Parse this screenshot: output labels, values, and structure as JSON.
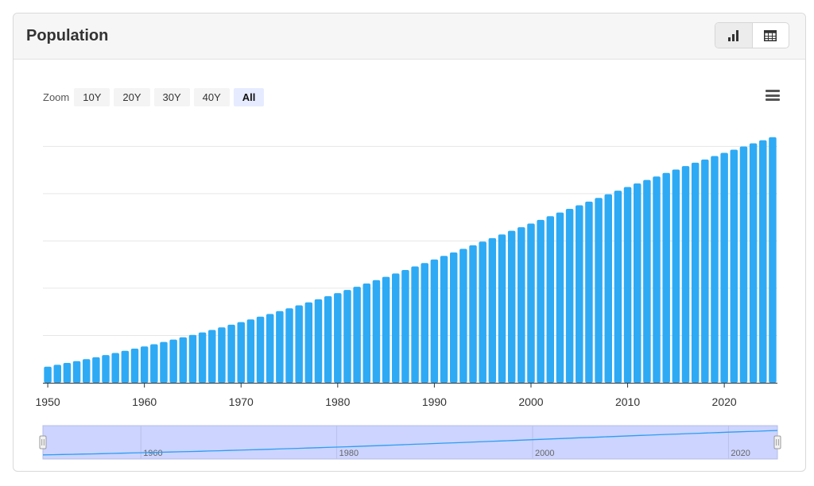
{
  "header": {
    "title": "Population"
  },
  "view_toggle": {
    "chart_icon": "bar-chart-icon",
    "table_icon": "table-icon"
  },
  "zoom": {
    "label": "Zoom",
    "options": [
      "10Y",
      "20Y",
      "30Y",
      "40Y",
      "All"
    ],
    "selected": "All"
  },
  "menu": {
    "icon": "hamburger-menu-icon"
  },
  "colors": {
    "bar": "#2eaaf5",
    "navigator_fill": "#ccd4ff",
    "navigator_line": "#2e9ef0",
    "grid": "#e6e6e6"
  },
  "chart_data": {
    "type": "bar",
    "x": [
      1950,
      1951,
      1952,
      1953,
      1954,
      1955,
      1956,
      1957,
      1958,
      1959,
      1960,
      1961,
      1962,
      1963,
      1964,
      1965,
      1966,
      1967,
      1968,
      1969,
      1970,
      1971,
      1972,
      1973,
      1974,
      1975,
      1976,
      1977,
      1978,
      1979,
      1980,
      1981,
      1982,
      1983,
      1984,
      1985,
      1986,
      1987,
      1988,
      1989,
      1990,
      1991,
      1992,
      1993,
      1994,
      1995,
      1996,
      1997,
      1998,
      1999,
      2000,
      2001,
      2002,
      2003,
      2004,
      2005,
      2006,
      2007,
      2008,
      2009,
      2010,
      2011,
      2012,
      2013,
      2014,
      2015,
      2016,
      2017,
      2018,
      2019,
      2020,
      2021,
      2022,
      2023,
      2024,
      2025
    ],
    "values": [
      13.6,
      15.2,
      16.8,
      18.3,
      20.0,
      21.6,
      23.4,
      25.2,
      27.0,
      28.9,
      30.7,
      32.6,
      34.5,
      36.5,
      38.5,
      40.5,
      42.6,
      44.7,
      46.9,
      49.1,
      51.3,
      53.6,
      55.9,
      58.2,
      60.6,
      63.0,
      65.5,
      68.0,
      70.6,
      73.2,
      75.8,
      78.5,
      81.2,
      84.0,
      86.8,
      89.6,
      92.5,
      95.4,
      98.4,
      101.3,
      104.3,
      107.3,
      110.3,
      113.3,
      116.3,
      119.4,
      122.4,
      125.5,
      128.6,
      131.6,
      134.7,
      137.8,
      140.9,
      144.0,
      147.1,
      150.2,
      153.3,
      156.4,
      159.5,
      162.5,
      165.6,
      168.6,
      171.6,
      174.5,
      177.5,
      180.4,
      183.3,
      186.2,
      188.9,
      191.8,
      194.5,
      197.2,
      199.9,
      202.6,
      205.2,
      207.8
    ],
    "ylim": [
      0,
      215
    ],
    "x_ticks": [
      1950,
      1960,
      1970,
      1980,
      1990,
      2000,
      2010,
      2020
    ],
    "navigator_ticks": [
      1960,
      1980,
      2000,
      2020
    ],
    "grid": true,
    "legend": "none"
  }
}
